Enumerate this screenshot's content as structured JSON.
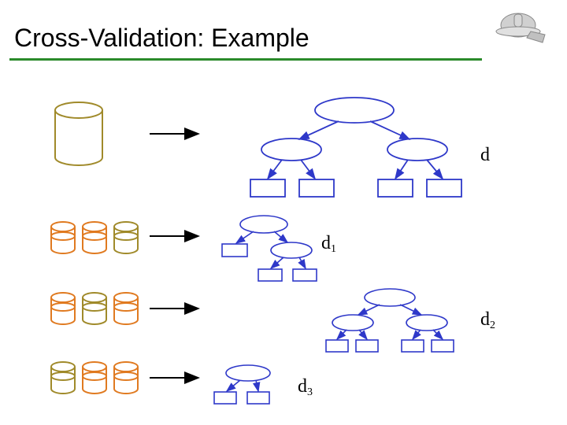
{
  "title": "Cross-Validation: Example",
  "labels": {
    "d": "d",
    "d1": {
      "base": "d",
      "sub": "1"
    },
    "d2": {
      "base": "d",
      "sub": "2"
    },
    "d3": {
      "base": "d",
      "sub": "3"
    }
  },
  "colors": {
    "tree_node": "#2e38c9",
    "cyl_olive": "#a08a2a",
    "cyl_orange": "#e07a20",
    "cyl_gray": "#9a9a9a",
    "underline": "#2a8a2a",
    "arrow": "#000000"
  },
  "rows": [
    {
      "cylinders": [
        "olive"
      ],
      "big": true,
      "tree": "full-large"
    },
    {
      "cylinders": [
        "orange",
        "orange",
        "olive"
      ],
      "tree": "small-top"
    },
    {
      "cylinders": [
        "orange",
        "olive",
        "orange"
      ],
      "tree": "full-small"
    },
    {
      "cylinders": [
        "olive",
        "orange",
        "orange"
      ],
      "tree": "tiny"
    }
  ]
}
